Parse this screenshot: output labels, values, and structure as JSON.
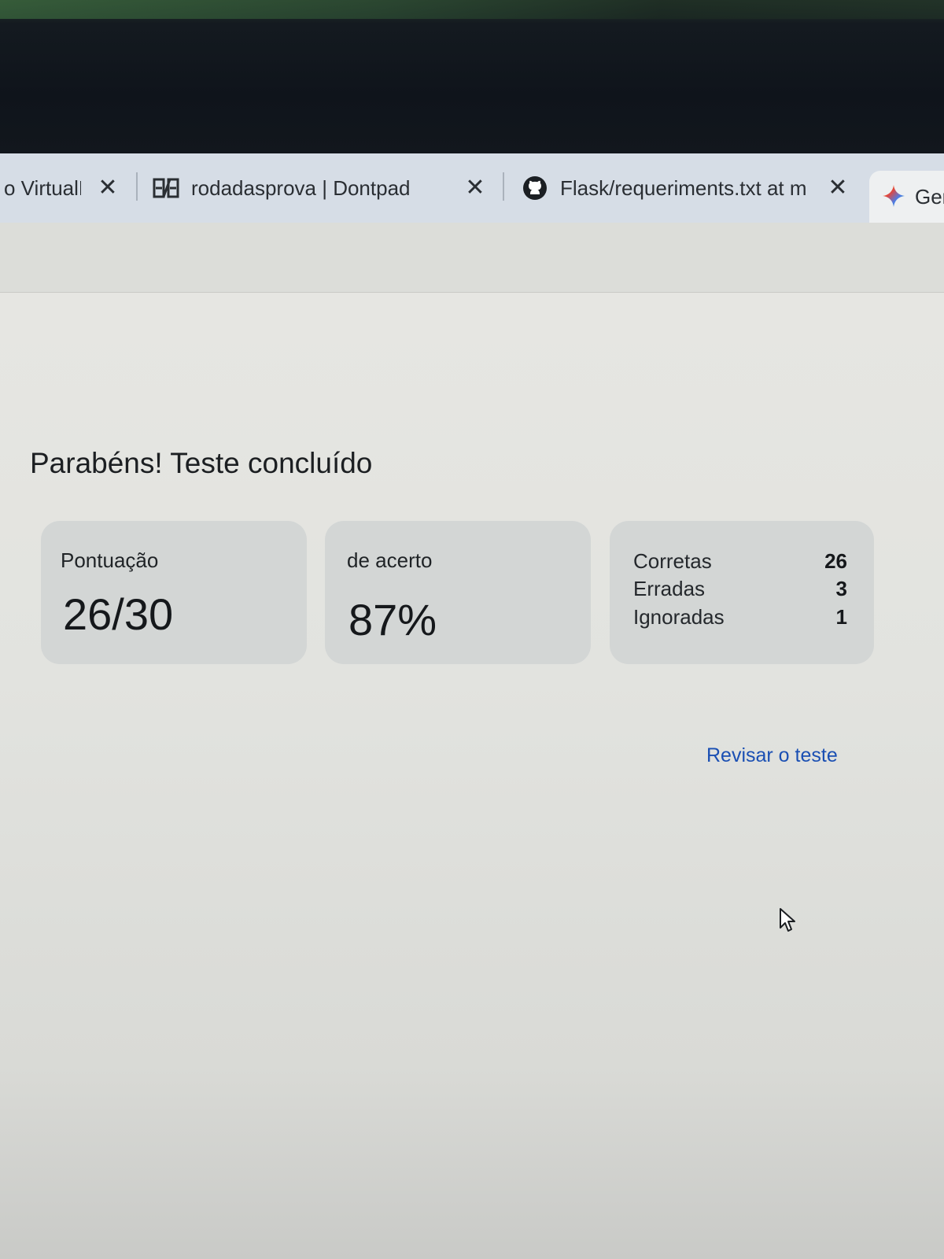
{
  "browser": {
    "tabs": [
      {
        "title": "o VirtualE",
        "icon": "globe-icon"
      },
      {
        "title": "rodadasprova | Dontpad",
        "icon": "dontpad-icon"
      },
      {
        "title": "Flask/requeriments.txt at main",
        "icon": "github-icon"
      },
      {
        "title": "Ger",
        "icon": "gemini-sparkle-icon"
      }
    ]
  },
  "result": {
    "heading": "Parabéns! Teste concluído",
    "score_label": "Pontuação",
    "score_value": "26/30",
    "percent_label": "de acerto",
    "percent_value": "87%",
    "stats": [
      {
        "label": "Corretas",
        "value": "26"
      },
      {
        "label": "Erradas",
        "value": "3"
      },
      {
        "label": "Ignoradas",
        "value": "1"
      }
    ],
    "review_link": "Revisar o teste"
  },
  "colors": {
    "link": "#1a4fb3",
    "card_background": "#d3d6d5",
    "tab_strip": "#d6dde6"
  }
}
